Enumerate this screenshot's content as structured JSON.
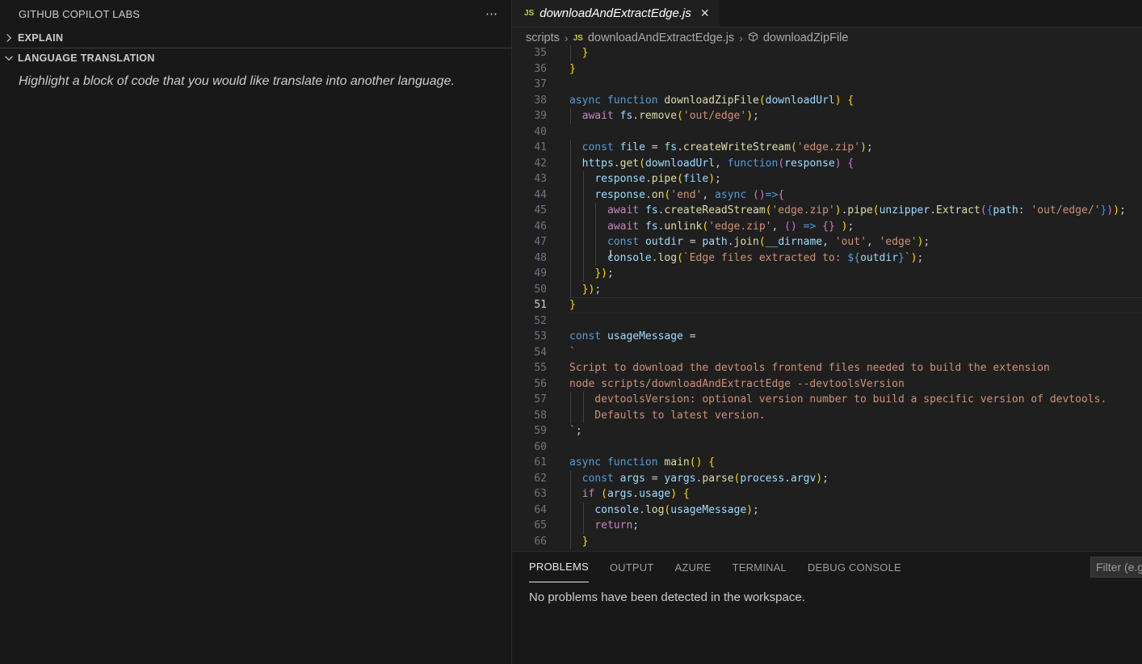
{
  "sidebar": {
    "title": "GITHUB COPILOT LABS",
    "more_icon": "⋯",
    "sections": [
      {
        "label": "EXPLAIN",
        "expanded": false
      },
      {
        "label": "LANGUAGE TRANSLATION",
        "expanded": true
      }
    ],
    "hint": "Highlight a block of code that you would like translate into another language."
  },
  "editor": {
    "tab": {
      "icon": "JS",
      "label": "downloadAndExtractEdge.js",
      "close": "✕"
    },
    "breadcrumbs": {
      "folder": "scripts",
      "file_icon": "JS",
      "file": "downloadAndExtractEdge.js",
      "symbol": "downloadZipFile"
    },
    "lines": [
      {
        "n": "35",
        "t": "  }"
      },
      {
        "n": "36",
        "t": "}"
      },
      {
        "n": "37",
        "t": ""
      },
      {
        "n": "38",
        "t": "async function downloadZipFile(downloadUrl) {"
      },
      {
        "n": "39",
        "t": "  await fs.remove('out/edge');"
      },
      {
        "n": "40",
        "t": ""
      },
      {
        "n": "41",
        "t": "  const file = fs.createWriteStream('edge.zip');"
      },
      {
        "n": "42",
        "t": "  https.get(downloadUrl, function(response) {"
      },
      {
        "n": "43",
        "t": "    response.pipe(file);"
      },
      {
        "n": "44",
        "t": "    response.on('end', async ()=>{"
      },
      {
        "n": "45",
        "t": "      await fs.createReadStream('edge.zip').pipe(unzipper.Extract({path: 'out/edge/'}));"
      },
      {
        "n": "46",
        "t": "      await fs.unlink('edge.zip', () => {} );"
      },
      {
        "n": "47",
        "t": "      const outdir = path.join(__dirname, 'out', 'edge');"
      },
      {
        "n": "48",
        "t": "      console.log(`Edge files extracted to: ${outdir}`);"
      },
      {
        "n": "49",
        "t": "    });"
      },
      {
        "n": "50",
        "t": "  });"
      },
      {
        "n": "51",
        "t": "}"
      },
      {
        "n": "52",
        "t": ""
      },
      {
        "n": "53",
        "t": "const usageMessage ="
      },
      {
        "n": "54",
        "t": "`"
      },
      {
        "n": "55",
        "t": "Script to download the devtools frontend files needed to build the extension"
      },
      {
        "n": "56",
        "t": "node scripts/downloadAndExtractEdge --devtoolsVersion"
      },
      {
        "n": "57",
        "t": "    devtoolsVersion: optional version number to build a specific version of devtools."
      },
      {
        "n": "58",
        "t": "    Defaults to latest version."
      },
      {
        "n": "59",
        "t": "`;"
      },
      {
        "n": "60",
        "t": ""
      },
      {
        "n": "61",
        "t": "async function main() {"
      },
      {
        "n": "62",
        "t": "  const args = yargs.parse(process.argv);"
      },
      {
        "n": "63",
        "t": "  if (args.usage) {"
      },
      {
        "n": "64",
        "t": "    console.log(usageMessage);"
      },
      {
        "n": "65",
        "t": "    return;"
      },
      {
        "n": "66",
        "t": "  }"
      }
    ],
    "current_line": "51"
  },
  "panel": {
    "tabs": [
      "PROBLEMS",
      "OUTPUT",
      "AZURE",
      "TERMINAL",
      "DEBUG CONSOLE"
    ],
    "active_tab": "PROBLEMS",
    "filter_placeholder": "Filter (e.g",
    "message": "No problems have been detected in the workspace."
  }
}
